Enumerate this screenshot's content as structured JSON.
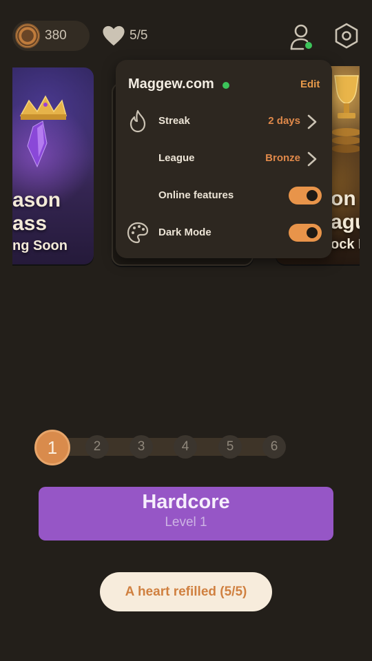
{
  "topbar": {
    "coins": "380",
    "hearts": "5/5",
    "coin_icon": "coin-icon",
    "heart_icon": "heart-icon",
    "profile_icon": "user-icon",
    "settings_icon": "gear-icon"
  },
  "carousel": {
    "left_card": {
      "line1": "ason",
      "line2": "ass",
      "line3": "ng Soon"
    },
    "right_card": {
      "line1": "on",
      "line2": "agu",
      "line3": "ock L"
    }
  },
  "profile_popup": {
    "username": "Maggew.com",
    "edit_label": "Edit",
    "rows": [
      {
        "label": "Streak",
        "value": "2 days",
        "icon": "flame-icon"
      },
      {
        "label": "League",
        "value": "Bronze"
      },
      {
        "label": "Online features",
        "toggle_on": true
      },
      {
        "label": "Dark Mode",
        "toggle_on": true,
        "icon": "palette-icon"
      }
    ]
  },
  "level_stepper": {
    "steps": [
      "1",
      "2",
      "3",
      "4",
      "5",
      "6"
    ],
    "active": "1"
  },
  "mode": {
    "title": "Hardcore",
    "level": "Level 1"
  },
  "toast": {
    "message": "A heart refilled (5/5)"
  },
  "colors": {
    "background": "#231f1a",
    "accent": "#e8944a",
    "mode_purple": "#9656c6",
    "online_green": "#3cc45a"
  }
}
